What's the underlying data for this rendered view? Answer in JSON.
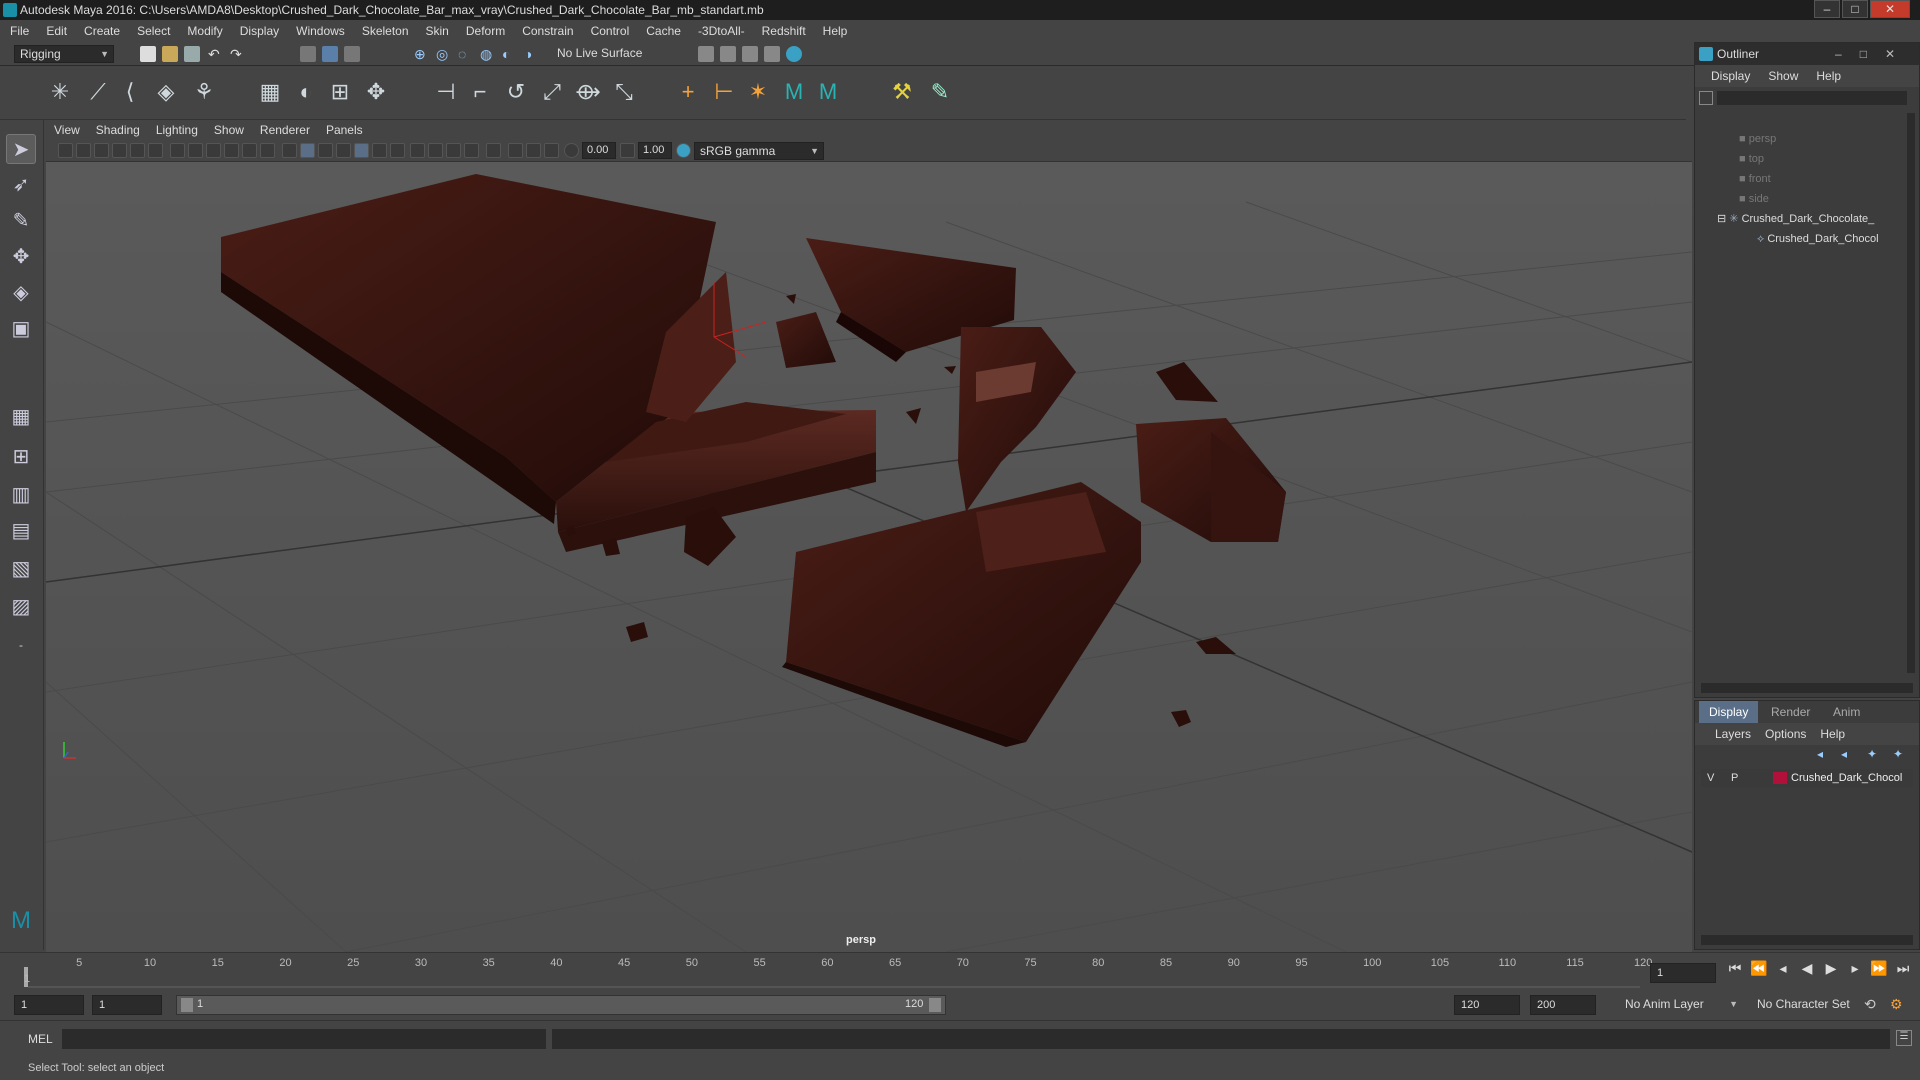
{
  "window": {
    "title": "Autodesk Maya 2016: C:\\Users\\AMDA8\\Desktop\\Crushed_Dark_Chocolate_Bar_max_vray\\Crushed_Dark_Chocolate_Bar_mb_standart.mb",
    "controls": [
      "–",
      "□",
      "✕"
    ]
  },
  "menubar": [
    "File",
    "Edit",
    "Create",
    "Select",
    "Modify",
    "Display",
    "Windows",
    "Skeleton",
    "Skin",
    "Deform",
    "Constrain",
    "Control",
    "Cache",
    "-3DtoAll-",
    "Redshift",
    "Help"
  ],
  "statusline": {
    "menuset": "Rigging",
    "live_surface": "No Live Surface"
  },
  "viewport": {
    "menu": [
      "View",
      "Shading",
      "Lighting",
      "Show",
      "Renderer",
      "Panels"
    ],
    "exposure": "0.00",
    "gamma": "1.00",
    "color_space": "sRGB gamma",
    "camera_label": "persp"
  },
  "outliner": {
    "title": "Outliner",
    "menu": [
      "Display",
      "Show",
      "Help"
    ],
    "items": [
      {
        "label": "persp",
        "icon": "camera-icon"
      },
      {
        "label": "top",
        "icon": "camera-icon"
      },
      {
        "label": "front",
        "icon": "camera-icon"
      },
      {
        "label": "side",
        "icon": "camera-icon"
      },
      {
        "label": "Crushed_Dark_Chocolate_",
        "icon": "joint-icon"
      },
      {
        "label": "Crushed_Dark_Chocol",
        "icon": "mesh-icon"
      }
    ]
  },
  "layer_editor": {
    "tabs": [
      "Display",
      "Render",
      "Anim"
    ],
    "menu": [
      "Layers",
      "Options",
      "Help"
    ],
    "layer": {
      "visible": "V",
      "playback": "P",
      "name": "Crushed_Dark_Chocol",
      "color": "#b0103a"
    }
  },
  "timeslider": {
    "ticks": [
      "5",
      "10",
      "15",
      "20",
      "25",
      "30",
      "35",
      "40",
      "45",
      "50",
      "55",
      "60",
      "65",
      "70",
      "75",
      "80",
      "85",
      "90",
      "95",
      "100",
      "105",
      "110",
      "115",
      "120"
    ],
    "first_tick": "1",
    "current_frame": "1"
  },
  "rangeslider": {
    "start": "1",
    "current": "1",
    "range_start": "1",
    "range_end": "120",
    "end": "120",
    "max": "200",
    "anim_layer": "No Anim Layer",
    "character_set": "No Character Set"
  },
  "cmdline": {
    "label": "MEL"
  },
  "helpline": {
    "text": "Select Tool: select an object"
  },
  "colors": {
    "accent": "#5a6f87",
    "chocolate": "#3a1712",
    "maya_teal": "#1a8fa8"
  }
}
